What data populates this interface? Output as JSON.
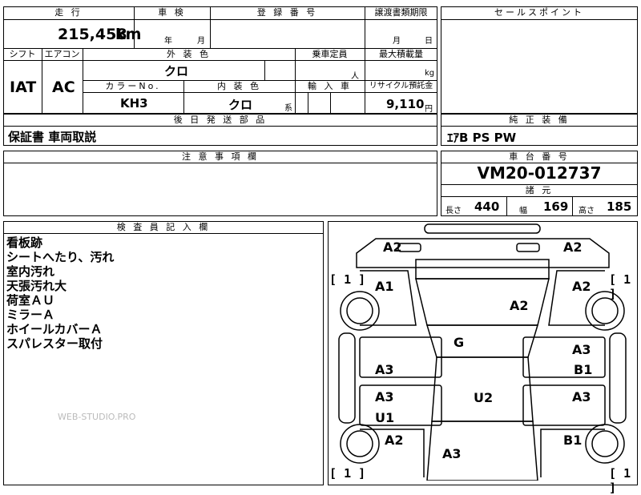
{
  "top": {
    "mileage_header": "走 行",
    "shaken_header": "車 検",
    "reg_header": "登 録 番 号",
    "transfer_header": "譲渡書類期限",
    "mileage_value": "215,458",
    "mileage_unit": "km",
    "year_unit": "年",
    "month_unit": "月",
    "transfer_month": "月",
    "transfer_day": "日"
  },
  "row2": {
    "shift_header": "シフト",
    "ac_header": "エアコン",
    "exterior_header": "外 装 色",
    "capacity_header": "乗車定員",
    "maxload_header": "最大積載量",
    "shift_value": "IAT",
    "ac_value": "AC",
    "exterior_value": "クロ",
    "capacity_unit": "人",
    "maxload_unit": "kg",
    "colorno_header": "カラーNo.",
    "interior_header": "内 装 色",
    "import_header": "輸 入 車",
    "recycle_header": "リサイクル預託金",
    "colorno_value": "KH3",
    "interior_value": "クロ",
    "interior_suffix": "系",
    "recycle_value": "9,110",
    "recycle_unit": "円"
  },
  "postal": {
    "header": "後 日 発 送 部 品",
    "value": "保証書 車両取説"
  },
  "notes": {
    "header": "注 意 事 項 欄"
  },
  "sales": {
    "header": "セールスポイント"
  },
  "equipment": {
    "header": "純 正 装 備",
    "value": "ｴｱB PS PW"
  },
  "chassis": {
    "header": "車 台 番 号",
    "value": "VM20-012737",
    "dims_header": "諸 元",
    "length_label": "長さ",
    "length_value": "440",
    "width_label": "幅",
    "width_value": "169",
    "height_label": "高さ",
    "height_value": "185"
  },
  "inspector": {
    "header": "検 査 員 記 入 欄",
    "lines": [
      "看板跡",
      "シートへたり、汚れ",
      "室内汚れ",
      "天張汚れ大",
      "荷室ＡＵ",
      "ミラーＡ",
      "ホイールカバーＡ",
      "スパレスター取付"
    ],
    "watermark": "WEB-STUDIO.PRO"
  },
  "diagram": {
    "labels": {
      "top_left": "A2",
      "top_right": "A2",
      "front_left_door": "A1",
      "front_right_door": "A2",
      "roof": "A2",
      "windshield": "G",
      "left_mid_top": "A3",
      "right_mid_top_a": "A3",
      "right_mid_top_b": "B1",
      "left_mid_bottom_a": "A3",
      "left_mid_bottom_b": "U1",
      "center": "U2",
      "right_mid_bottom": "A3",
      "rear_left": "A2",
      "rear_right": "B1",
      "rear_center": "A3"
    },
    "bracket_value_1": "1",
    "bracket_value_2": "1",
    "bracket_value_3": "1",
    "bracket_value_4": "1"
  }
}
